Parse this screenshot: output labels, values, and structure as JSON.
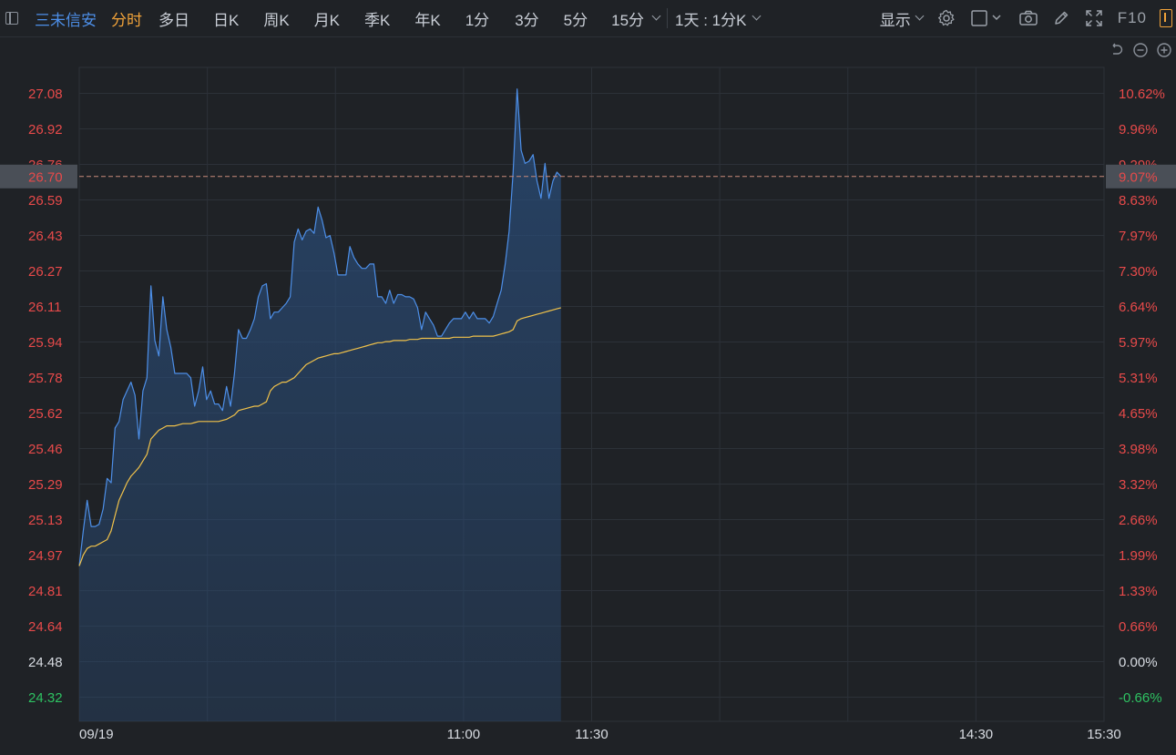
{
  "toolbar": {
    "stock_name": "三未信安",
    "tabs": [
      "分时",
      "多日",
      "日K",
      "周K",
      "月K",
      "季K",
      "年K",
      "1分",
      "3分",
      "5分",
      "15分"
    ],
    "active_tab": 0,
    "period_selector": "1天 : 1分K",
    "display_label": "显示",
    "f10_label": "F10"
  },
  "colors": {
    "background": "#1f2226",
    "grid": "#2c3138",
    "price_line": "#4d8fe8",
    "avg_line": "#f1c24a",
    "area_top": "#2a4d7a",
    "up": "#e84a4a",
    "down": "#2ec262",
    "neutral": "#d8dce2",
    "crosshair_label_bg": "#4a4f57",
    "accent_orange": "#f1a33a"
  },
  "chart_data": {
    "type": "line",
    "x_labels": [
      "09/19",
      "11:00",
      "11:30",
      "14:30",
      "15:30"
    ],
    "y_left_ticks": [
      "27.08",
      "26.92",
      "26.76",
      "26.59",
      "26.43",
      "26.27",
      "26.11",
      "25.94",
      "25.78",
      "25.62",
      "25.46",
      "25.29",
      "25.13",
      "24.97",
      "24.81",
      "24.64",
      "24.48",
      "24.32"
    ],
    "y_right_ticks": [
      "10.62%",
      "9.96%",
      "9.29%",
      "8.63%",
      "7.97%",
      "7.30%",
      "6.64%",
      "5.97%",
      "5.31%",
      "4.65%",
      "3.98%",
      "3.32%",
      "2.66%",
      "1.99%",
      "1.33%",
      "0.66%",
      "0.00%",
      "-0.66%"
    ],
    "prev_close": 24.48,
    "ylim": [
      24.32,
      27.08
    ],
    "total_minutes": 240,
    "current_price_label": "26.70",
    "current_pct_label": "9.07%",
    "current_price": 26.7,
    "series": [
      {
        "name": "price",
        "values": [
          24.92,
          25.08,
          25.22,
          25.1,
          25.1,
          25.11,
          25.18,
          25.32,
          25.3,
          25.55,
          25.58,
          25.68,
          25.72,
          25.76,
          25.7,
          25.5,
          25.72,
          25.78,
          26.2,
          25.95,
          25.88,
          26.15,
          26.0,
          25.92,
          25.8,
          25.8,
          25.8,
          25.8,
          25.78,
          25.65,
          25.72,
          25.83,
          25.68,
          25.72,
          25.66,
          25.66,
          25.63,
          25.74,
          25.65,
          25.8,
          26.0,
          25.96,
          25.96,
          26.0,
          26.05,
          26.15,
          26.2,
          26.21,
          26.05,
          26.08,
          26.08,
          26.1,
          26.12,
          26.15,
          26.4,
          26.46,
          26.41,
          26.45,
          26.46,
          26.44,
          26.56,
          26.5,
          26.42,
          26.43,
          26.35,
          26.25,
          26.25,
          26.25,
          26.38,
          26.33,
          26.3,
          26.28,
          26.28,
          26.3,
          26.3,
          26.15,
          26.15,
          26.12,
          26.18,
          26.12,
          26.16,
          26.16,
          26.15,
          26.15,
          26.14,
          26.1,
          26.0,
          26.08,
          26.05,
          26.02,
          25.97,
          25.97,
          26.0,
          26.03,
          26.05,
          26.05,
          26.05,
          26.08,
          26.05,
          26.08,
          26.05,
          26.05,
          26.05,
          26.03,
          26.06,
          26.12,
          26.18,
          26.3,
          26.45,
          26.72,
          27.1,
          26.82,
          26.76,
          26.77,
          26.8,
          26.68,
          26.6,
          26.76,
          26.6,
          26.68,
          26.72,
          26.7
        ]
      },
      {
        "name": "average",
        "values": [
          24.92,
          24.97,
          25.0,
          25.01,
          25.01,
          25.02,
          25.03,
          25.04,
          25.08,
          25.15,
          25.22,
          25.26,
          25.3,
          25.33,
          25.35,
          25.37,
          25.4,
          25.43,
          25.5,
          25.52,
          25.54,
          25.55,
          25.56,
          25.56,
          25.56,
          25.565,
          25.57,
          25.57,
          25.57,
          25.575,
          25.58,
          25.58,
          25.58,
          25.58,
          25.58,
          25.58,
          25.585,
          25.59,
          25.6,
          25.61,
          25.63,
          25.635,
          25.64,
          25.645,
          25.65,
          25.65,
          25.66,
          25.67,
          25.72,
          25.74,
          25.75,
          25.76,
          25.76,
          25.77,
          25.78,
          25.8,
          25.82,
          25.84,
          25.85,
          25.86,
          25.87,
          25.875,
          25.88,
          25.885,
          25.89,
          25.89,
          25.895,
          25.9,
          25.905,
          25.91,
          25.915,
          25.92,
          25.925,
          25.93,
          25.935,
          25.94,
          25.94,
          25.945,
          25.945,
          25.95,
          25.95,
          25.95,
          25.95,
          25.955,
          25.955,
          25.955,
          25.96,
          25.96,
          25.96,
          25.96,
          25.96,
          25.96,
          25.96,
          25.96,
          25.965,
          25.965,
          25.965,
          25.965,
          25.965,
          25.97,
          25.97,
          25.97,
          25.97,
          25.97,
          25.97,
          25.975,
          25.98,
          25.985,
          25.99,
          26.0,
          26.04,
          26.05,
          26.055,
          26.06,
          26.065,
          26.07,
          26.075,
          26.08,
          26.085,
          26.09,
          26.095,
          26.1
        ]
      }
    ],
    "grid": true
  }
}
